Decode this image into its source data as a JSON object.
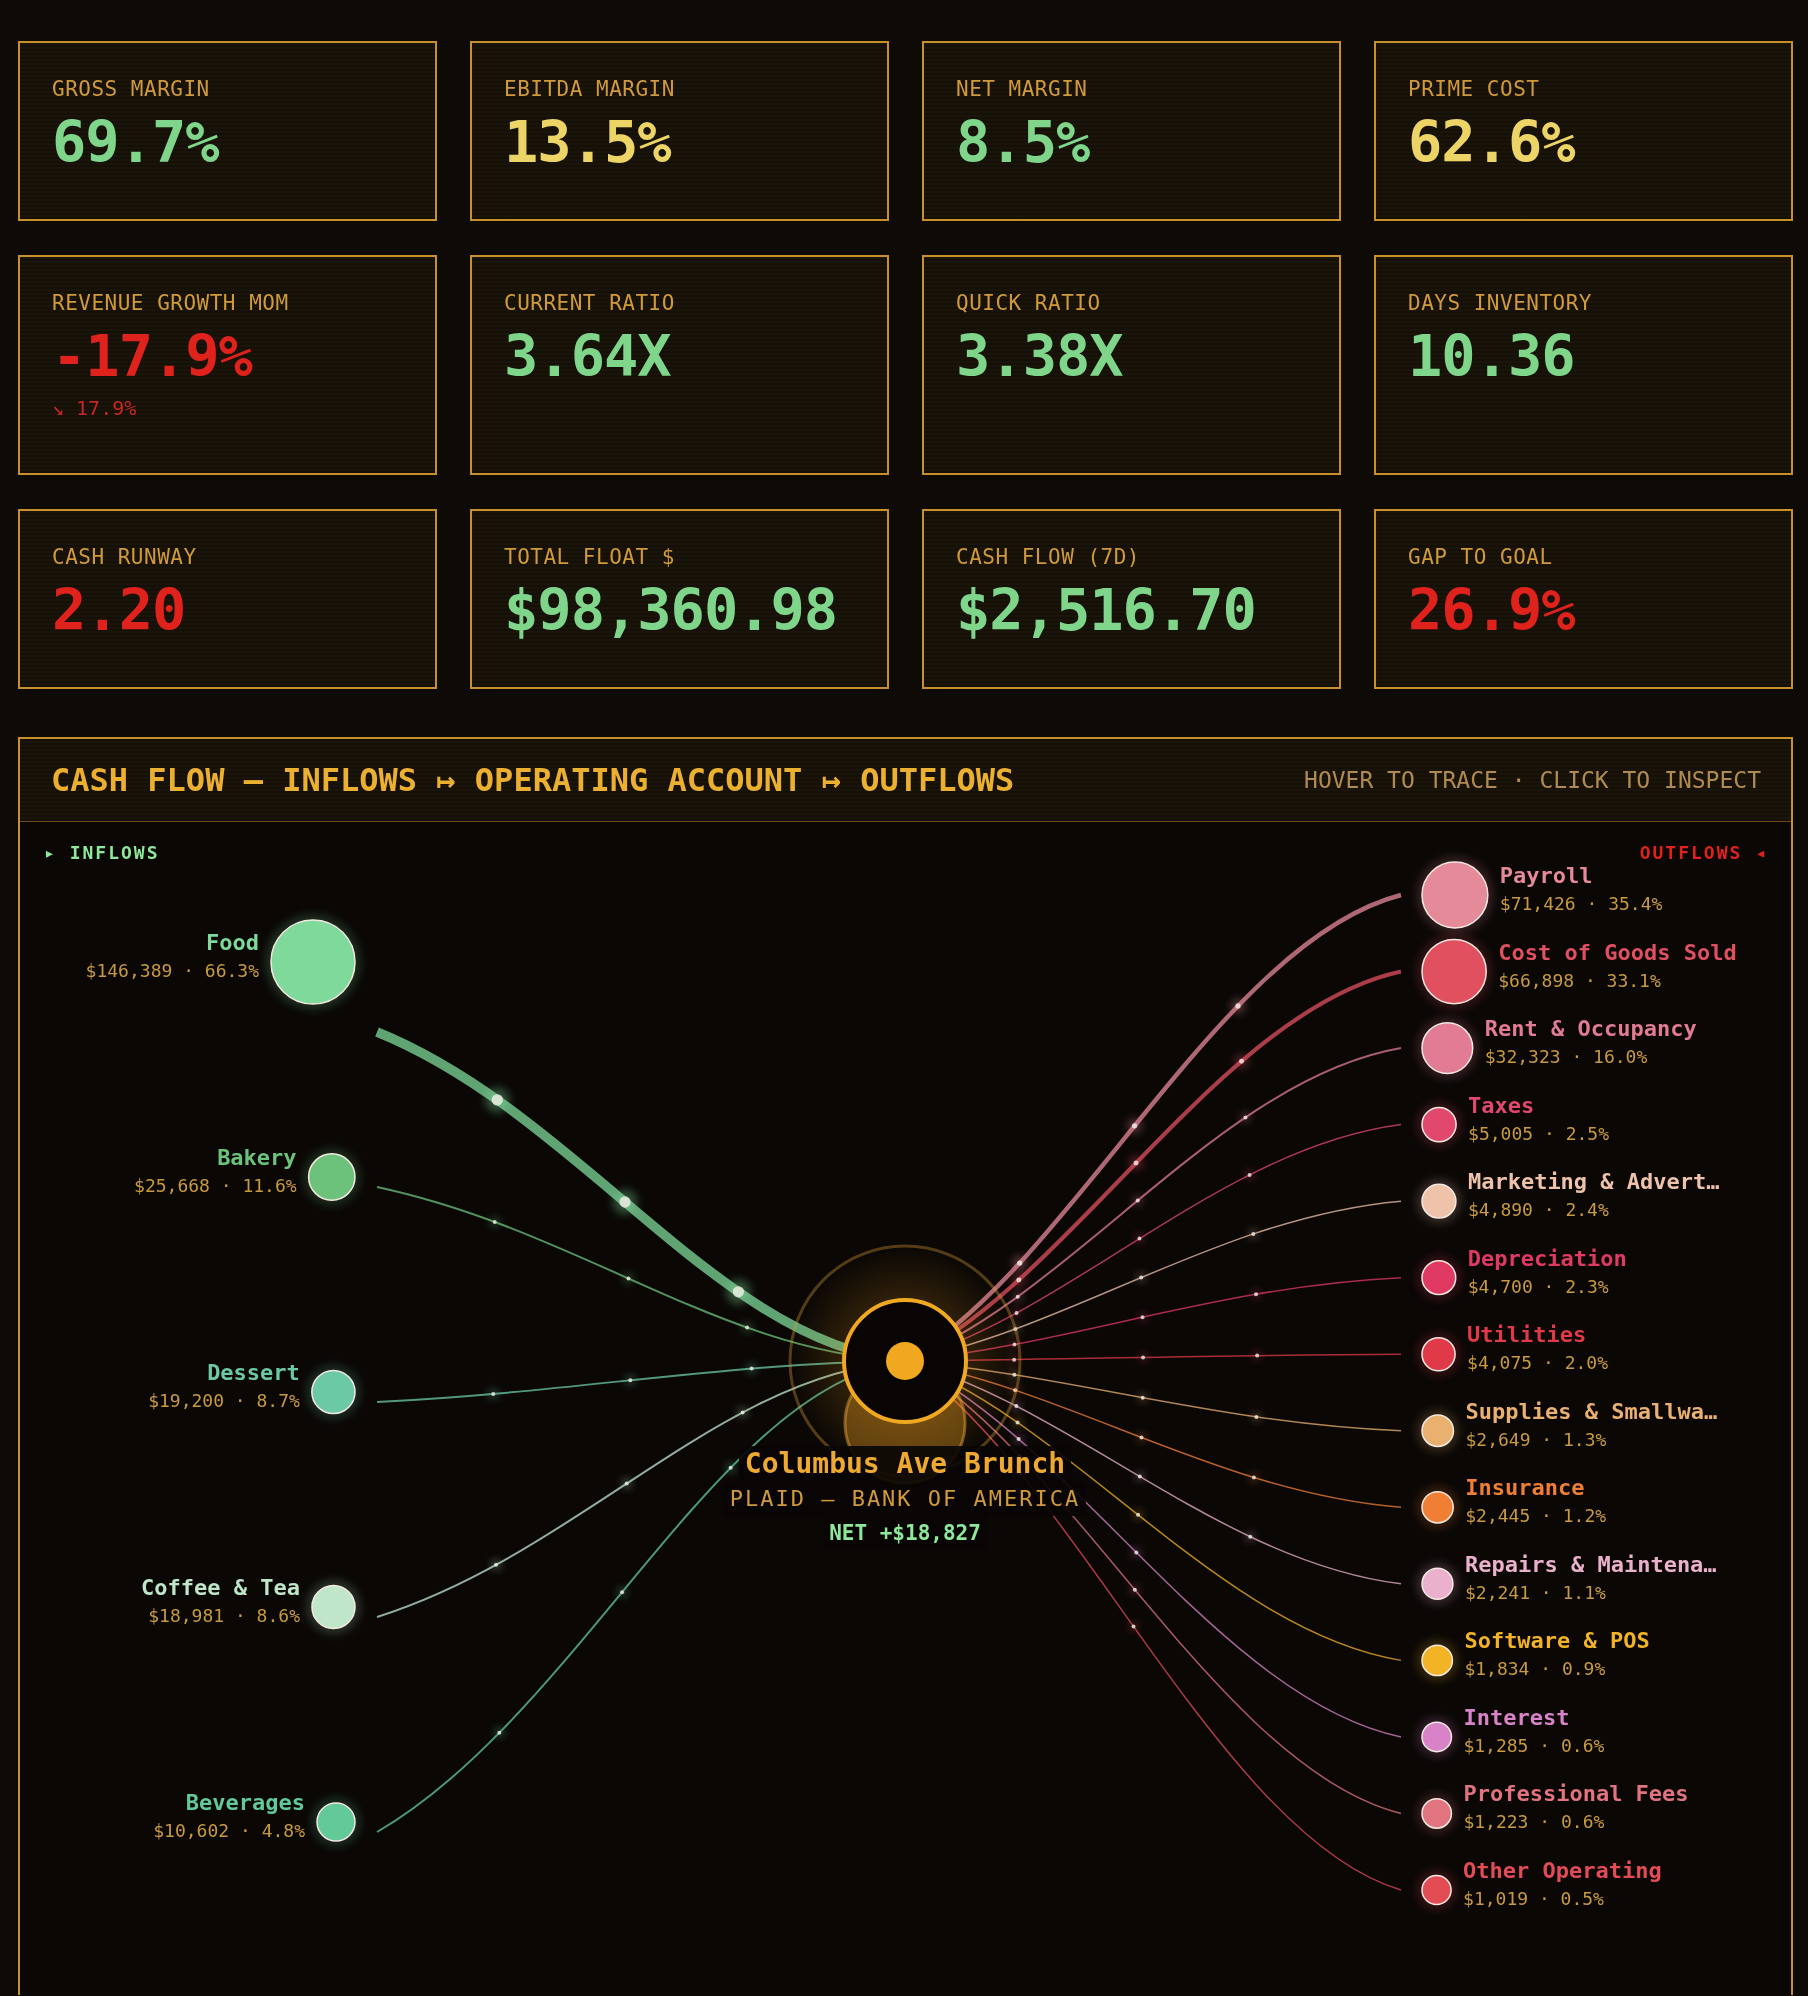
{
  "kpis": [
    {
      "label": "GROSS MARGIN",
      "value": "69.7%",
      "color": "#7fd68a"
    },
    {
      "label": "EBITDA MARGIN",
      "value": "13.5%",
      "color": "#ecd466"
    },
    {
      "label": "NET MARGIN",
      "value": "8.5%",
      "color": "#7fd68a"
    },
    {
      "label": "PRIME COST",
      "value": "62.6%",
      "color": "#ecd466"
    },
    {
      "label": "REVENUE GROWTH MOM",
      "value": "-17.9%",
      "color": "#e0221c",
      "trend": "↘ 17.9%"
    },
    {
      "label": "CURRENT RATIO",
      "value": "3.64X",
      "color": "#7fd68a"
    },
    {
      "label": "QUICK RATIO",
      "value": "3.38X",
      "color": "#7fd68a"
    },
    {
      "label": "DAYS INVENTORY",
      "value": "10.36",
      "color": "#7fd68a"
    },
    {
      "label": "CASH RUNWAY",
      "value": "2.20",
      "color": "#e0221c"
    },
    {
      "label": "TOTAL FLOAT $",
      "value": "$98,360.98",
      "color": "#7fd68a"
    },
    {
      "label": "CASH FLOW (7D)",
      "value": "$2,516.70",
      "color": "#7fd68a"
    },
    {
      "label": "GAP TO GOAL",
      "value": "26.9%",
      "color": "#e0221c"
    }
  ],
  "flow": {
    "title": "CASH FLOW — INFLOWS ↦ OPERATING ACCOUNT ↦ OUTFLOWS",
    "hint": "HOVER TO TRACE · CLICK TO INSPECT",
    "inflows_label": "▸ INFLOWS",
    "outflows_label": "OUTFLOWS ◂",
    "account": {
      "name": "Columbus Ave Brunch",
      "source": "PLAID — BANK OF AMERICA",
      "net": "NET +$18,827"
    },
    "inflows": [
      {
        "name": "Food",
        "detail": "$146,389 · 66.3%",
        "color": "#7ed99a"
      },
      {
        "name": "Bakery",
        "detail": "$25,668 · 11.6%",
        "color": "#6cc27a"
      },
      {
        "name": "Dessert",
        "detail": "$19,200 · 8.7%",
        "color": "#6cc9a6"
      },
      {
        "name": "Coffee & Tea",
        "detail": "$18,981 · 8.6%",
        "color": "#bfe6c8"
      },
      {
        "name": "Beverages",
        "detail": "$10,602 · 4.8%",
        "color": "#62c998"
      }
    ],
    "outflows": [
      {
        "name": "Payroll",
        "detail": "$71,426 · 35.4%",
        "color": "#e58a98"
      },
      {
        "name": "Cost of Goods Sold",
        "detail": "$66,898 · 33.1%",
        "color": "#e0505f"
      },
      {
        "name": "Rent & Occupancy",
        "detail": "$32,323 · 16.0%",
        "color": "#e27b94"
      },
      {
        "name": "Taxes",
        "detail": "$5,005 · 2.5%",
        "color": "#e2486c"
      },
      {
        "name": "Marketing & Advert…",
        "detail": "$4,890 · 2.4%",
        "color": "#eec3aa"
      },
      {
        "name": "Depreciation",
        "detail": "$4,700 · 2.3%",
        "color": "#e03a62"
      },
      {
        "name": "Utilities",
        "detail": "$4,075 · 2.0%",
        "color": "#e03a48"
      },
      {
        "name": "Supplies & Smallwa…",
        "detail": "$2,649 · 1.3%",
        "color": "#eab070"
      },
      {
        "name": "Insurance",
        "detail": "$2,445 · 1.2%",
        "color": "#f07f35"
      },
      {
        "name": "Repairs & Maintena…",
        "detail": "$2,241 · 1.1%",
        "color": "#eab0cc"
      },
      {
        "name": "Software & POS",
        "detail": "$1,834 · 0.9%",
        "color": "#f2b324"
      },
      {
        "name": "Interest",
        "detail": "$1,285 · 0.6%",
        "color": "#d883c8"
      },
      {
        "name": "Professional Fees",
        "detail": "$1,223 · 0.6%",
        "color": "#e27480"
      },
      {
        "name": "Other Operating",
        "detail": "$1,019 · 0.5%",
        "color": "#e34c55"
      }
    ]
  }
}
